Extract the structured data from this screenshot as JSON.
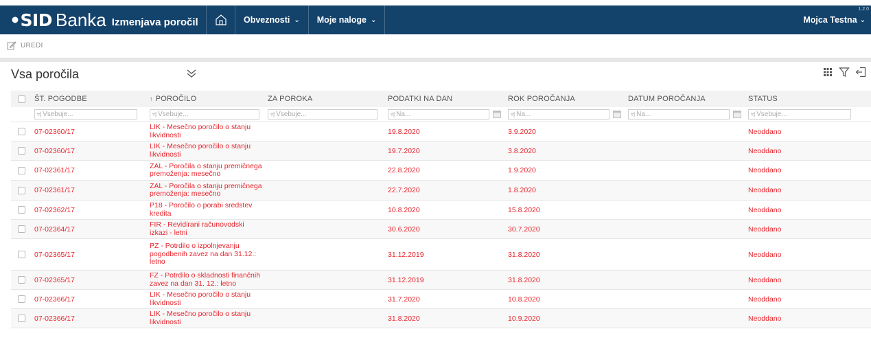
{
  "header": {
    "logo_text": "•SID",
    "brand_name": "Banka",
    "app_subtitle": "Izmenjava poročil",
    "nav": [
      {
        "label": "Obveznosti"
      },
      {
        "label": "Moje naloge"
      }
    ],
    "user_name": "Mojca Testna",
    "version": "1.2.0"
  },
  "toolbar": {
    "edit_label": "UREDI"
  },
  "panel": {
    "title": "Vsa poročila"
  },
  "table": {
    "columns": [
      "ŠT. POGODBE",
      "POROČILO",
      "ZA POROKA",
      "PODATKI NA DAN",
      "ROK POROČANJA",
      "DATUM POROČANJA",
      "STATUS"
    ],
    "filters": {
      "contains_placeholder": "Vsebuje...",
      "on_placeholder": "Na..."
    },
    "rows": [
      {
        "pogodba": "07-02360/17",
        "porocilo": "LIK - Mesečno poročilo o stanju likvidnosti",
        "za_poroka": "",
        "podatki_na_dan": "19.8.2020",
        "rok_porocanja": "3.9.2020",
        "datum_porocanja": "",
        "status": "Neoddano"
      },
      {
        "pogodba": "07-02360/17",
        "porocilo": "LIK - Mesečno poročilo o stanju likvidnosti",
        "za_poroka": "",
        "podatki_na_dan": "19.7.2020",
        "rok_porocanja": "3.8.2020",
        "datum_porocanja": "",
        "status": "Neoddano"
      },
      {
        "pogodba": "07-02361/17",
        "porocilo": "ZAL - Poročila o stanju premičnega premoženja: mesečno",
        "za_poroka": "",
        "podatki_na_dan": "22.8.2020",
        "rok_porocanja": "1.9.2020",
        "datum_porocanja": "",
        "status": "Neoddano"
      },
      {
        "pogodba": "07-02361/17",
        "porocilo": "ZAL - Poročila o stanju premičnega premoženja: mesečno",
        "za_poroka": "",
        "podatki_na_dan": "22.7.2020",
        "rok_porocanja": "1.8.2020",
        "datum_porocanja": "",
        "status": "Neoddano"
      },
      {
        "pogodba": "07-02362/17",
        "porocilo": "P18 - Poročilo o porabi sredstev kredita",
        "za_poroka": "",
        "podatki_na_dan": "10.8.2020",
        "rok_porocanja": "15.8.2020",
        "datum_porocanja": "",
        "status": "Neoddano"
      },
      {
        "pogodba": "07-02364/17",
        "porocilo": "FIR - Revidirani računovodski izkazi - letni",
        "za_poroka": "",
        "podatki_na_dan": "30.6.2020",
        "rok_porocanja": "30.7.2020",
        "datum_porocanja": "",
        "status": "Neoddano"
      },
      {
        "pogodba": "07-02365/17",
        "porocilo": "PZ - Potrdilo o izpolnjevanju pogodbenih zavez na dan 31.12.: letno",
        "za_poroka": "",
        "podatki_na_dan": "31.12.2019",
        "rok_porocanja": "31.8.2020",
        "datum_porocanja": "",
        "status": "Neoddano"
      },
      {
        "pogodba": "07-02365/17",
        "porocilo": "FZ - Potrdilo o skladnosti finančnih zavez na dan 31. 12.: letno",
        "za_poroka": "",
        "podatki_na_dan": "31.12.2019",
        "rok_porocanja": "31.8.2020",
        "datum_porocanja": "",
        "status": "Neoddano"
      },
      {
        "pogodba": "07-02366/17",
        "porocilo": "LIK - Mesečno poročilo o stanju likvidnosti",
        "za_poroka": "",
        "podatki_na_dan": "31.7.2020",
        "rok_porocanja": "10.8.2020",
        "datum_porocanja": "",
        "status": "Neoddano"
      },
      {
        "pogodba": "07-02366/17",
        "porocilo": "LIK - Mesečno poročilo o stanju likvidnosti",
        "za_poroka": "",
        "podatki_na_dan": "31.8.2020",
        "rok_porocanja": "10.9.2020",
        "datum_porocanja": "",
        "status": "Neoddano"
      }
    ]
  },
  "colors": {
    "topbar": "#13426b",
    "accent_red": "#e8252d",
    "header_row": "#f3f3f3"
  },
  "icons": [
    "home-icon",
    "edit-icon",
    "chevrons-down-icon",
    "grid-view-icon",
    "filter-icon",
    "export-icon",
    "calendar-icon",
    "filter-funnel-icon"
  ]
}
